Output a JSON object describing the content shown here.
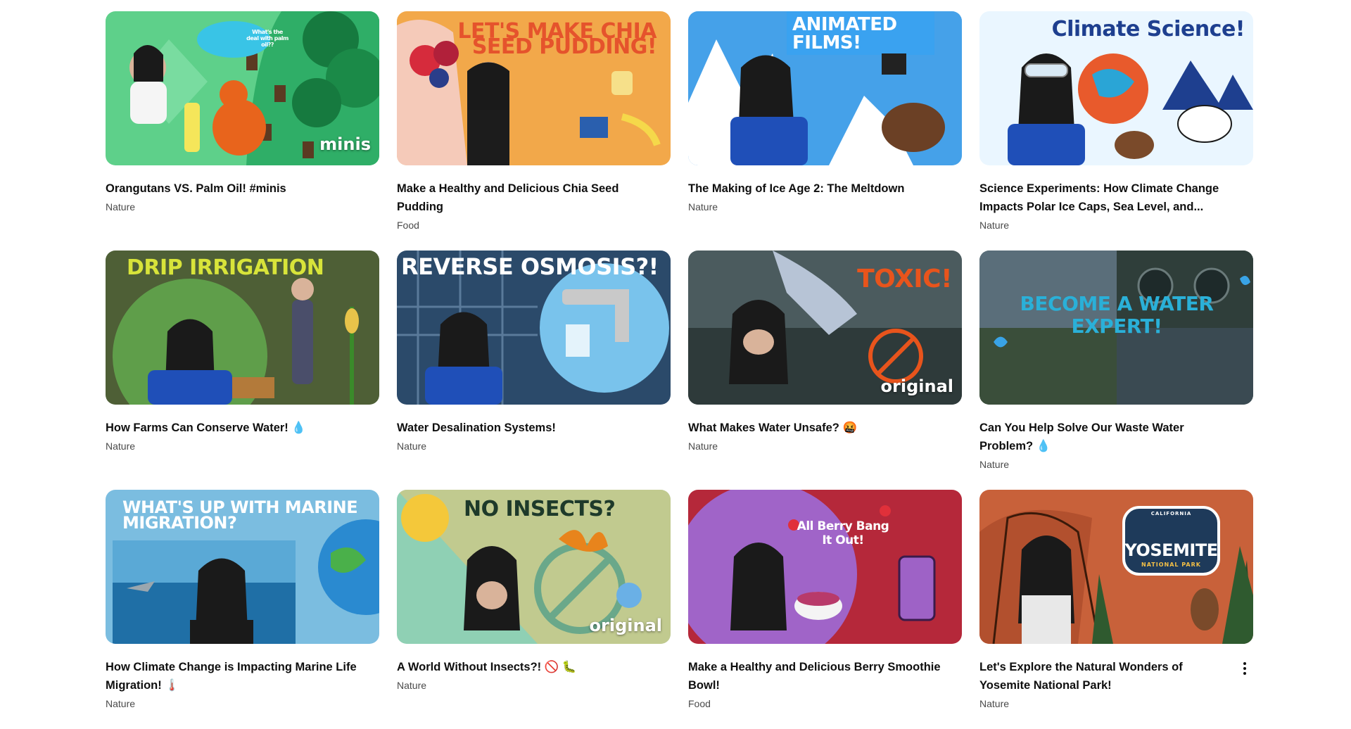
{
  "cards": [
    {
      "title": "Orangutans VS. Palm Oil! #minis",
      "category": "Nature",
      "thumb_text": "What's the deal with palm oil??",
      "badge": "minis",
      "bg": "#5ed08a"
    },
    {
      "title": "Make a Healthy and Delicious Chia Seed Pudding",
      "category": "Food",
      "thumb_text": "LET'S MAKE CHIA SEED PUDDING!",
      "bg": "#f2a84a"
    },
    {
      "title": "The Making of Ice Age 2: The Meltdown",
      "category": "Nature",
      "thumb_text": "ANIMATED FILMS!",
      "bg": "#1e88e5"
    },
    {
      "title": "Science Experiments: How Climate Change Impacts Polar Ice Caps, Sea Level, and...",
      "category": "Nature",
      "thumb_text": "Climate Science!",
      "bg": "#eaf6ff"
    },
    {
      "title": "How Farms Can Conserve Water! 💧",
      "category": "Nature",
      "thumb_text": "DRIP IRRIGATION",
      "bg": "#3f6b3a"
    },
    {
      "title": "Water Desalination Systems!",
      "category": "Nature",
      "thumb_text": "REVERSE OSMOSIS?!",
      "bg": "#2b4a6a"
    },
    {
      "title": "What Makes Water Unsafe? 🤬",
      "category": "Nature",
      "thumb_text": "TOXIC!",
      "badge": "original",
      "bg": "#4b5b5e"
    },
    {
      "title": "Can You Help Solve Our Waste Water Problem? 💧",
      "category": "Nature",
      "thumb_text": "BECOME A WATER EXPERT!",
      "bg": "#4a5a4e"
    },
    {
      "title": "How Climate Change is Impacting Marine Life Migration! 🌡️",
      "category": "Nature",
      "thumb_text": "WHAT'S UP WITH MARINE MIGRATION?",
      "bg": "#7bbde0"
    },
    {
      "title": "A World Without Insects?! 🚫 🐛",
      "category": "Nature",
      "thumb_text": "NO INSECTS?",
      "badge": "original",
      "bg": "#8fd0b4"
    },
    {
      "title": "Make a Healthy and Delicious Berry Smoothie Bowl!",
      "category": "Food",
      "thumb_text": "All Berry Bang It Out!",
      "bg": "#b5283a"
    },
    {
      "title": "Let's Explore the Natural Wonders of Yosemite National Park!",
      "category": "Nature",
      "thumb_text": "YOSEMITE",
      "thumb_subtext": "NATIONAL PARK",
      "thumb_arc": "CALIFORNIA",
      "bg": "#c8613a"
    }
  ],
  "icons": {
    "more": "more-vert-icon"
  }
}
